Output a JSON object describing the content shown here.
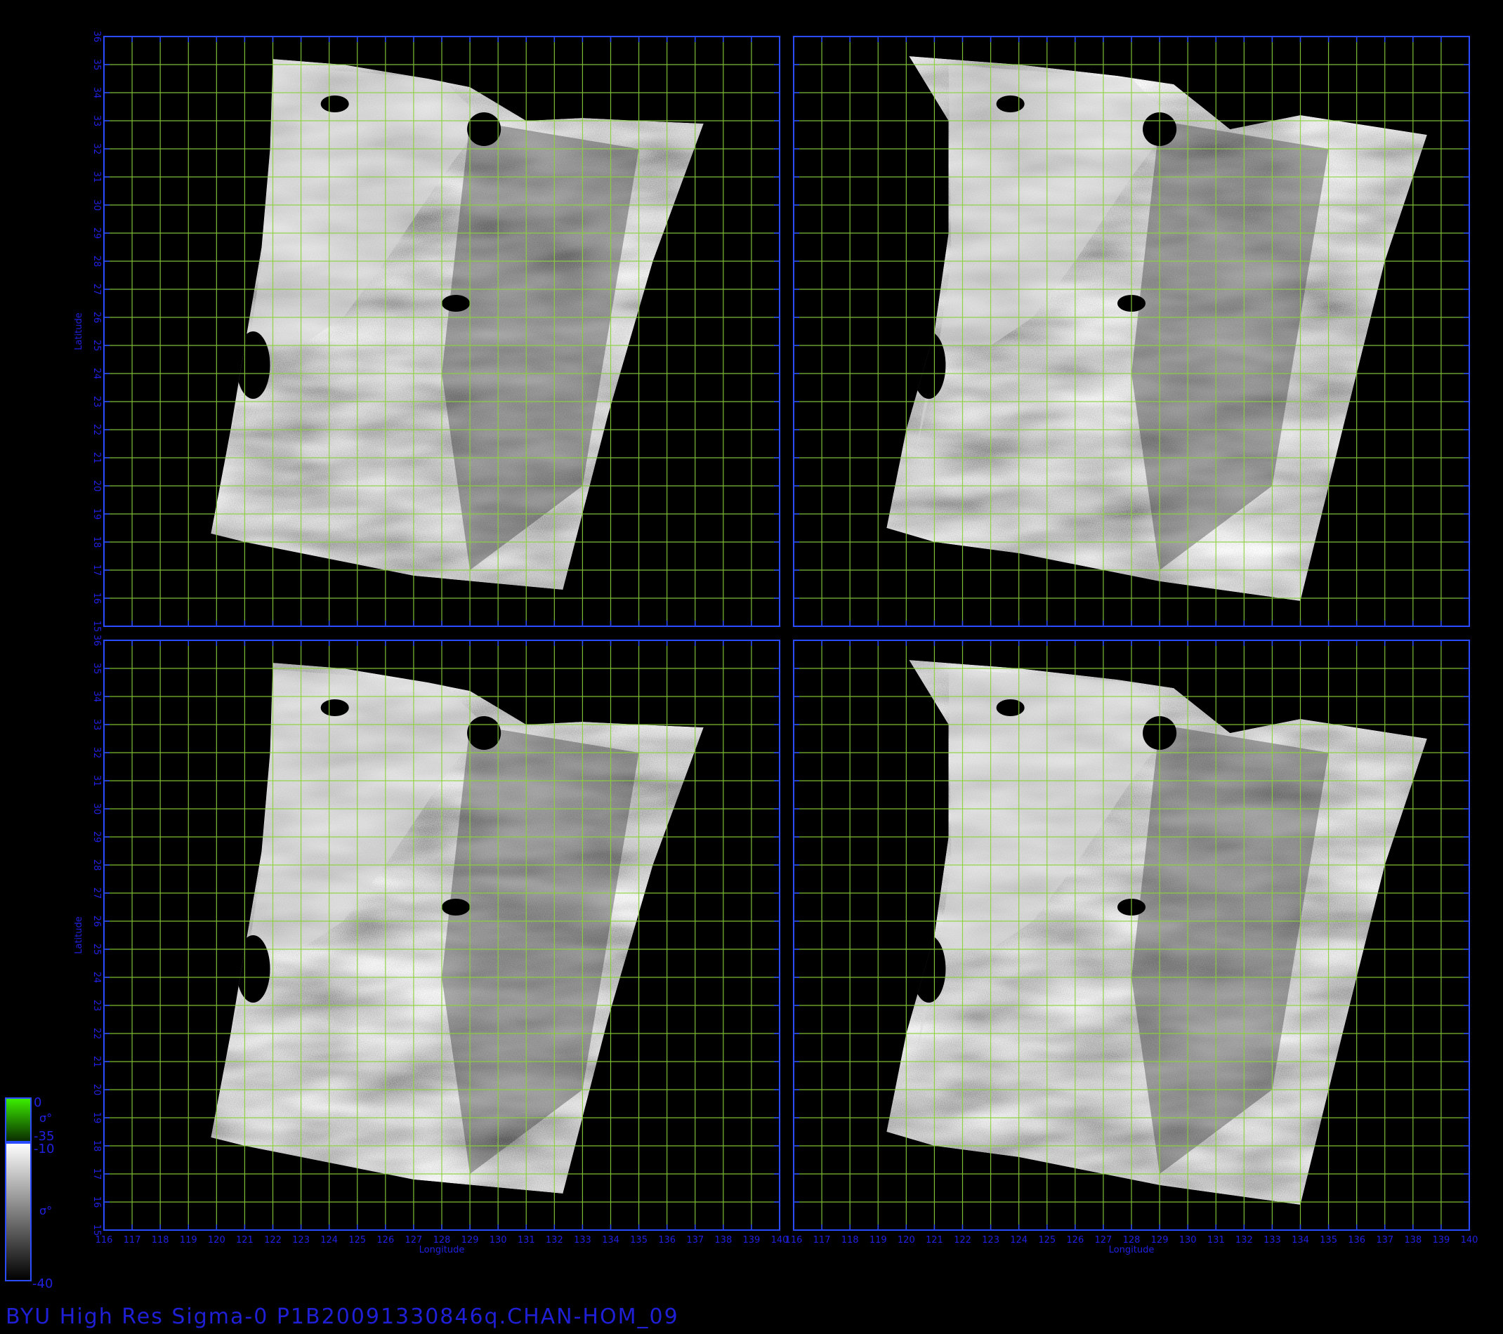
{
  "title": "BYU High Res Sigma-0 P1B20091330846q.CHAN-HOM_09",
  "colors": {
    "background": "#000000",
    "frame": "#2a4bff",
    "grid": "#8cd23c",
    "label": "#2020e0"
  },
  "axes": {
    "lon_min": 116,
    "lon_max": 140,
    "lat_min": 15,
    "lat_max": 36,
    "xlabel": "Longitude",
    "ylabel": "Latitude",
    "lon_ticks": [
      "116",
      "117",
      "118",
      "119",
      "120",
      "121",
      "122",
      "123",
      "124",
      "125",
      "126",
      "127",
      "128",
      "129",
      "130",
      "131",
      "132",
      "133",
      "134",
      "135",
      "136",
      "137",
      "138",
      "139",
      "140"
    ],
    "lat_ticks": [
      "15",
      "16",
      "17",
      "18",
      "19",
      "20",
      "21",
      "22",
      "23",
      "24",
      "25",
      "26",
      "27",
      "28",
      "29",
      "30",
      "31",
      "32",
      "33",
      "34",
      "35",
      "36"
    ]
  },
  "panels": [
    {
      "id": "top-left"
    },
    {
      "id": "top-right"
    },
    {
      "id": "bottom-left"
    },
    {
      "id": "bottom-right"
    }
  ],
  "colorbar": {
    "green_top": "0",
    "green_sigma": "σ°",
    "green_bottom": "-35",
    "gray_top": "-10",
    "gray_sigma": "σ°",
    "gray_bottom": "-40"
  }
}
